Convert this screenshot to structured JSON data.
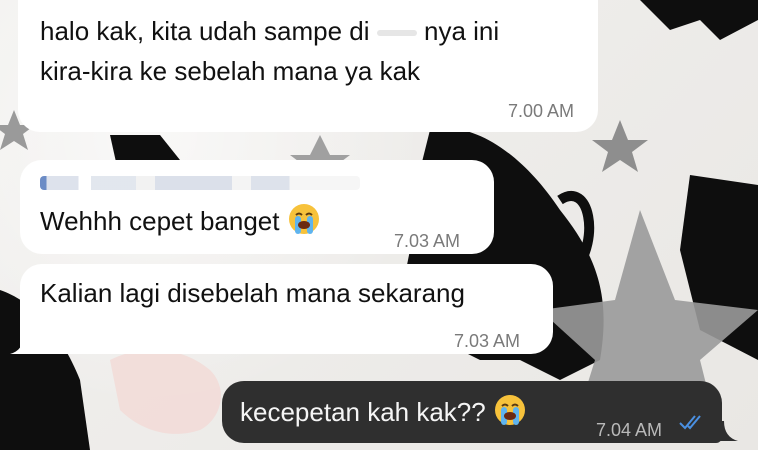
{
  "messages": [
    {
      "direction": "incoming",
      "text_part1": "halo kak, kita udah sampe di",
      "text_part2": "nya ini",
      "text_line2": "kira-kira ke sebelah mana ya kak",
      "time": "7.00 AM"
    },
    {
      "direction": "incoming",
      "text": "Wehhh cepet banget",
      "emoji": "loudly-crying-face",
      "time": "7.03 AM"
    },
    {
      "direction": "incoming",
      "text": "Kalian lagi disebelah mana sekarang",
      "time": "7.03 AM"
    },
    {
      "direction": "outgoing",
      "text": "kecepetan kah kak??",
      "emoji": "loudly-crying-face",
      "time": "7.04 AM",
      "status": "read-double-check"
    }
  ],
  "colors": {
    "incoming_bubble": "#ffffff",
    "outgoing_bubble": "#2f2f2f",
    "read_ticks": "#4a90e2",
    "timestamp": "#7a7a7a"
  }
}
